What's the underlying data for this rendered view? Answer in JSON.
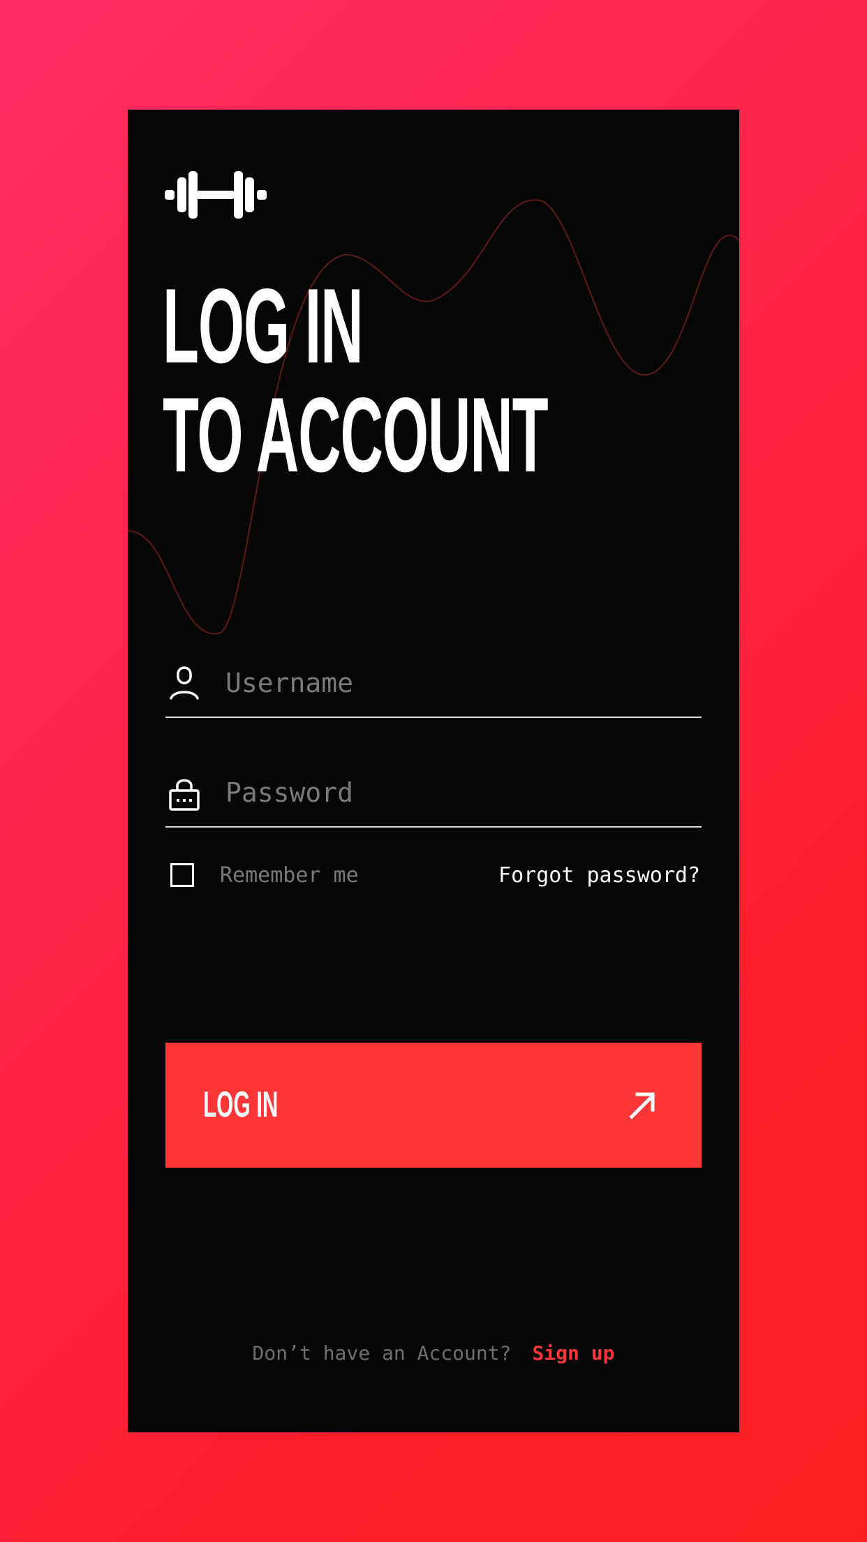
{
  "colors": {
    "background_gradient": [
      "#ff2b62",
      "#fa1f1f"
    ],
    "card": "#060606",
    "accent": "#fe3637",
    "text_primary": "#ffffff",
    "text_muted": "#7a7a7a"
  },
  "logo": {
    "icon": "dumbbell-icon"
  },
  "heading": {
    "line1": "LOG IN",
    "line2": "TO ACCOUNT"
  },
  "form": {
    "username": {
      "icon": "user-icon",
      "placeholder": "Username",
      "value": ""
    },
    "password": {
      "icon": "lock-icon",
      "placeholder": "Password",
      "value": ""
    },
    "remember": {
      "label": "Remember me",
      "checked": false
    },
    "forgot_label": "Forgot password?"
  },
  "login_button": {
    "label": "LOG IN",
    "icon": "arrow-up-right-icon"
  },
  "footer": {
    "question": "Don’t have an Account?",
    "signup_label": "Sign up"
  }
}
